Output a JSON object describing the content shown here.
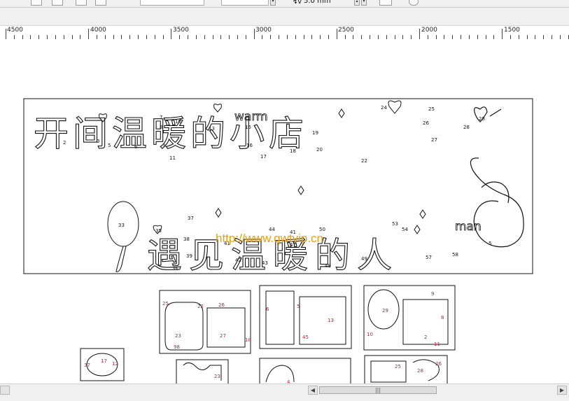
{
  "toolbar": {
    "size_field_value": "5.0 mm",
    "size_field_prefix": "↯v",
    "outline_field_value": ""
  },
  "ruler": {
    "labels": [
      "4500",
      "4000",
      "3500",
      "3000",
      "2500",
      "2000",
      "1500"
    ]
  },
  "canvas": {
    "watermark": "http://www.qwtvip.cn",
    "main_line_1": "开间温暖的小店",
    "main_line_2": "遇见温暖的人",
    "small_warm": "warm",
    "small_man": "man",
    "pieces_title": "",
    "small_num": "33"
  },
  "scrollbar": {
    "thumb_grip": "|||"
  },
  "colors": {
    "watermark": "#f0a000",
    "outline": "#111111",
    "piece_label": "#e0102a"
  }
}
